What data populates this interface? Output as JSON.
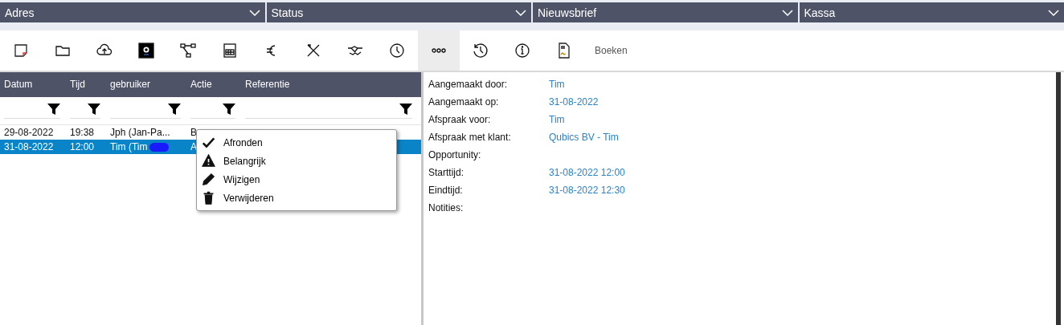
{
  "sections": [
    {
      "title": "Adres"
    },
    {
      "title": "Status"
    },
    {
      "title": "Nieuwsbrief"
    },
    {
      "title": "Kassa"
    }
  ],
  "toolbar": {
    "icons": [
      {
        "selected": false
      },
      {
        "selected": false
      },
      {
        "selected": false
      },
      {
        "selected": false
      },
      {
        "selected": false
      },
      {
        "selected": false
      },
      {
        "selected": false
      },
      {
        "selected": false
      },
      {
        "selected": false
      },
      {
        "selected": false
      },
      {
        "selected": true
      },
      {
        "selected": false
      },
      {
        "selected": false
      },
      {
        "selected": false
      }
    ],
    "text_button": "Boeken"
  },
  "table": {
    "columns": [
      "Datum",
      "Tijd",
      "gebruiker",
      "Actie",
      "Referentie"
    ],
    "rows": [
      {
        "cells": [
          "29-08-2022",
          "19:38",
          "Jph (Jan-Pa...",
          "B",
          ""
        ],
        "selected": false,
        "redacted": false
      },
      {
        "cells": [
          "31-08-2022",
          "12:00",
          "Tim (Tim",
          "A",
          ""
        ],
        "selected": true,
        "redacted": true
      }
    ]
  },
  "context_menu": [
    {
      "kind": "check",
      "label": "Afronden"
    },
    {
      "kind": "warning",
      "label": "Belangrijk"
    },
    {
      "kind": "edit",
      "label": "Wijzigen"
    },
    {
      "kind": "delete",
      "label": "Verwijderen"
    }
  ],
  "details": [
    {
      "label": "Aangemaakt door:",
      "value": "Tim"
    },
    {
      "label": "Aangemaakt op:",
      "value": "31-08-2022"
    },
    {
      "label": "Afspraak voor:",
      "value": "Tim"
    },
    {
      "label": "Afspraak met klant:",
      "value": "Qubics BV - Tim"
    },
    {
      "label": "Opportunity:"
    },
    {
      "label": "Starttijd:",
      "value": "31-08-2022 12:00"
    },
    {
      "label": "Eindtijd:",
      "value": "31-08-2022 12:30"
    },
    {
      "label": "Notities:"
    }
  ]
}
